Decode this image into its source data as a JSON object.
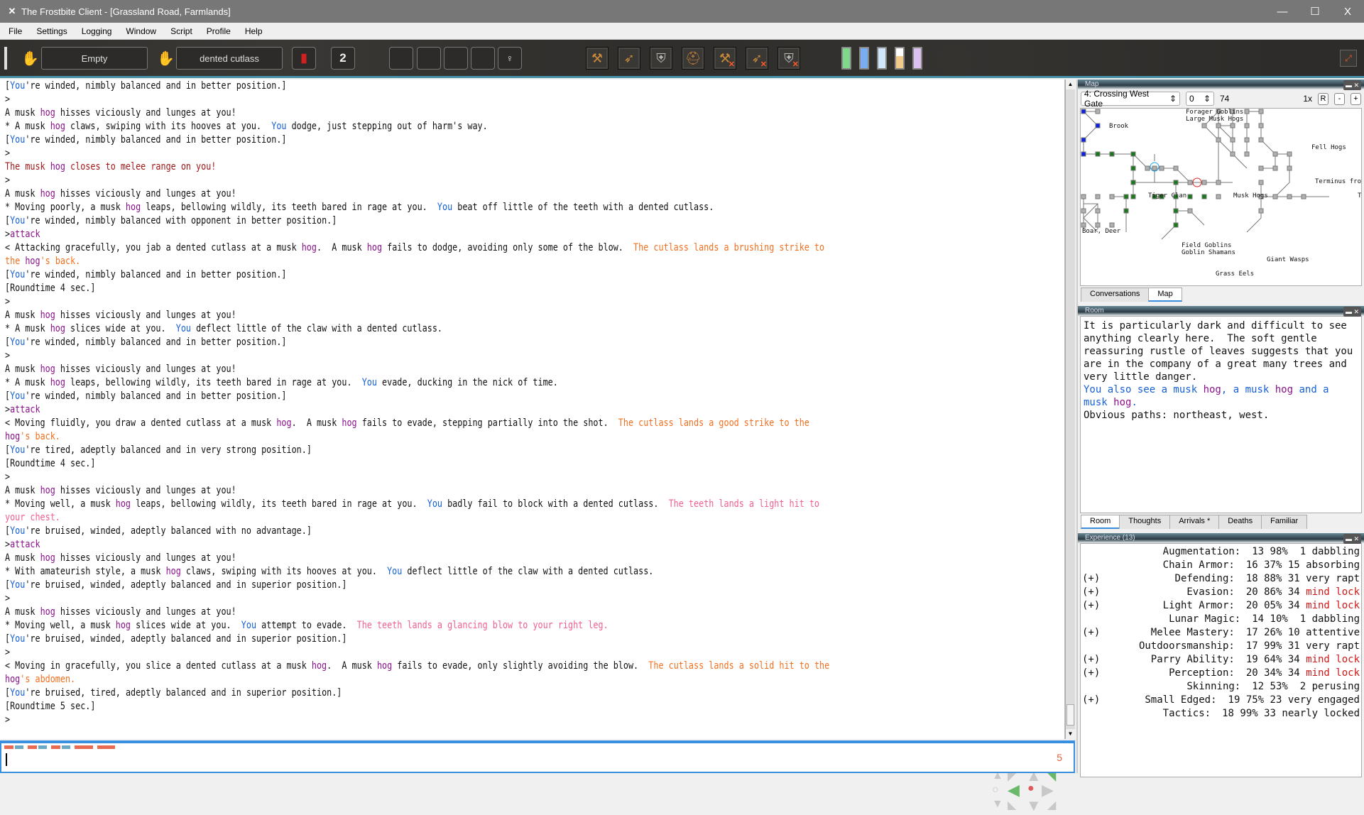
{
  "window": {
    "title": "The Frostbite Client - [Grassland Road, Farmlands]",
    "controls": {
      "minimize": "—",
      "maximize": "☐",
      "close": "X"
    }
  },
  "menu": [
    "File",
    "Settings",
    "Logging",
    "Window",
    "Script",
    "Profile",
    "Help"
  ],
  "toolbar": {
    "left_hand": "Empty",
    "right_hand": "dented cutlass",
    "spell_icon": "spellbook-icon",
    "count": "2",
    "stance_icon": "standing-figure-icon",
    "weapons": [
      {
        "icon": "axe-icon",
        "disabled": false
      },
      {
        "icon": "bow-icon",
        "disabled": false
      },
      {
        "icon": "shield-icon",
        "disabled": false
      },
      {
        "icon": "helmet-icon",
        "disabled": false
      },
      {
        "icon": "axe-icon",
        "disabled": true
      },
      {
        "icon": "bow-icon",
        "disabled": true
      },
      {
        "icon": "shield-icon",
        "disabled": true
      }
    ],
    "vitals": [
      {
        "name": "health",
        "color": "#7fd88a",
        "fill": 1.0
      },
      {
        "name": "mana",
        "color": "#78aef0",
        "fill": 1.0
      },
      {
        "name": "concentration",
        "color": "#cfe6fb",
        "fill": 1.0
      },
      {
        "name": "stamina",
        "color": "#f1c98a",
        "fill": 0.6
      },
      {
        "name": "spirit",
        "color": "#dcc0f0",
        "fill": 1.0
      }
    ]
  },
  "game_lines": [
    [
      [
        "[",
        ""
      ],
      [
        "You",
        "you"
      ],
      [
        "'re winded, nimbly balanced and in better position.]",
        ""
      ]
    ],
    [
      [
        ">",
        ""
      ]
    ],
    [
      [
        "A musk ",
        ""
      ],
      [
        "hog",
        "hog"
      ],
      [
        " hisses viciously and lunges at you!",
        ""
      ]
    ],
    [
      [
        "* A musk ",
        ""
      ],
      [
        "hog",
        "hog"
      ],
      [
        " claws, swiping with its hooves at you.  ",
        ""
      ],
      [
        "You",
        "you"
      ],
      [
        " dodge, just stepping out of harm's way.",
        ""
      ]
    ],
    [
      [
        "[",
        ""
      ],
      [
        "You",
        "you"
      ],
      [
        "'re winded, nimbly balanced and in better position.]",
        ""
      ]
    ],
    [
      [
        ">",
        ""
      ]
    ],
    [
      [
        "The musk ",
        "warn"
      ],
      [
        "hog",
        "hog"
      ],
      [
        " closes to melee range on you!",
        "warn"
      ]
    ],
    [
      [
        ">",
        ""
      ]
    ],
    [
      [
        "A musk ",
        ""
      ],
      [
        "hog",
        "hog"
      ],
      [
        " hisses viciously and lunges at you!",
        ""
      ]
    ],
    [
      [
        "* Moving poorly, a musk ",
        ""
      ],
      [
        "hog",
        "hog"
      ],
      [
        " leaps, bellowing wildly, its teeth bared in rage at you.  ",
        ""
      ],
      [
        "You",
        "you"
      ],
      [
        " beat off little of the teeth with a dented cutlass.",
        ""
      ]
    ],
    [
      [
        "[",
        ""
      ],
      [
        "You",
        "you"
      ],
      [
        "'re winded, nimbly balanced with opponent in better position.]",
        ""
      ]
    ],
    [
      [
        ">",
        ""
      ],
      [
        "attack",
        "cmd"
      ]
    ],
    [
      [
        "< Attacking gracefully, you jab a dented cutlass at a musk ",
        ""
      ],
      [
        "hog",
        "hog"
      ],
      [
        ".  A musk ",
        ""
      ],
      [
        "hog",
        "hog"
      ],
      [
        " fails to dodge, avoiding only some of the blow.  ",
        ""
      ],
      [
        "The cutlass lands a brushing strike to",
        "dmg"
      ]
    ],
    [
      [
        "the ",
        "dmg"
      ],
      [
        "hog",
        "hog"
      ],
      [
        "'s back.",
        "dmg"
      ]
    ],
    [
      [
        "[",
        ""
      ],
      [
        "You",
        "you"
      ],
      [
        "'re winded, nimbly balanced and in better position.]",
        ""
      ]
    ],
    [
      [
        "[Roundtime 4 sec.]",
        ""
      ]
    ],
    [
      [
        ">",
        ""
      ]
    ],
    [
      [
        "A musk ",
        ""
      ],
      [
        "hog",
        "hog"
      ],
      [
        " hisses viciously and lunges at you!",
        ""
      ]
    ],
    [
      [
        "* A musk ",
        ""
      ],
      [
        "hog",
        "hog"
      ],
      [
        " slices wide at you.  ",
        ""
      ],
      [
        "You",
        "you"
      ],
      [
        " deflect little of the claw with a dented cutlass.",
        ""
      ]
    ],
    [
      [
        "[",
        ""
      ],
      [
        "You",
        "you"
      ],
      [
        "'re winded, nimbly balanced and in better position.]",
        ""
      ]
    ],
    [
      [
        ">",
        ""
      ]
    ],
    [
      [
        "A musk ",
        ""
      ],
      [
        "hog",
        "hog"
      ],
      [
        " hisses viciously and lunges at you!",
        ""
      ]
    ],
    [
      [
        "* A musk ",
        ""
      ],
      [
        "hog",
        "hog"
      ],
      [
        " leaps, bellowing wildly, its teeth bared in rage at you.  ",
        ""
      ],
      [
        "You",
        "you"
      ],
      [
        " evade, ducking in the nick of time.",
        ""
      ]
    ],
    [
      [
        "[",
        ""
      ],
      [
        "You",
        "you"
      ],
      [
        "'re winded, nimbly balanced and in better position.]",
        ""
      ]
    ],
    [
      [
        ">",
        ""
      ],
      [
        "attack",
        "cmd"
      ]
    ],
    [
      [
        "< Moving fluidly, you draw a dented cutlass at a musk ",
        ""
      ],
      [
        "hog",
        "hog"
      ],
      [
        ".  A musk ",
        ""
      ],
      [
        "hog",
        "hog"
      ],
      [
        " fails to evade, stepping partially into the shot.  ",
        ""
      ],
      [
        "The cutlass lands a good strike to the",
        "dmg"
      ]
    ],
    [
      [
        "hog",
        "hog"
      ],
      [
        "'s back.",
        "dmg"
      ]
    ],
    [
      [
        "[",
        ""
      ],
      [
        "You",
        "you"
      ],
      [
        "'re tired, adeptly balanced and in very strong position.]",
        ""
      ]
    ],
    [
      [
        "[Roundtime 4 sec.]",
        ""
      ]
    ],
    [
      [
        ">",
        ""
      ]
    ],
    [
      [
        "A musk ",
        ""
      ],
      [
        "hog",
        "hog"
      ],
      [
        " hisses viciously and lunges at you!",
        ""
      ]
    ],
    [
      [
        "* Moving well, a musk ",
        ""
      ],
      [
        "hog",
        "hog"
      ],
      [
        " leaps, bellowing wildly, its teeth bared in rage at you.  ",
        ""
      ],
      [
        "You",
        "you"
      ],
      [
        " badly fail to block with a dented cutlass.  ",
        ""
      ],
      [
        "The teeth lands a light hit to",
        "hit"
      ]
    ],
    [
      [
        "your chest.",
        "hit"
      ]
    ],
    [
      [
        "[",
        ""
      ],
      [
        "You",
        "you"
      ],
      [
        "'re bruised, winded, adeptly balanced with no advantage.]",
        ""
      ]
    ],
    [
      [
        ">",
        ""
      ],
      [
        "attack",
        "cmd"
      ]
    ],
    [
      [
        "A musk ",
        ""
      ],
      [
        "hog",
        "hog"
      ],
      [
        " hisses viciously and lunges at you!",
        ""
      ]
    ],
    [
      [
        "* With amateurish style, a musk ",
        ""
      ],
      [
        "hog",
        "hog"
      ],
      [
        " claws, swiping with its hooves at you.  ",
        ""
      ],
      [
        "You",
        "you"
      ],
      [
        " deflect little of the claw with a dented cutlass.",
        ""
      ]
    ],
    [
      [
        "[",
        ""
      ],
      [
        "You",
        "you"
      ],
      [
        "'re bruised, winded, adeptly balanced and in superior position.]",
        ""
      ]
    ],
    [
      [
        ">",
        ""
      ]
    ],
    [
      [
        "A musk ",
        ""
      ],
      [
        "hog",
        "hog"
      ],
      [
        " hisses viciously and lunges at you!",
        ""
      ]
    ],
    [
      [
        "* Moving well, a musk ",
        ""
      ],
      [
        "hog",
        "hog"
      ],
      [
        " slices wide at you.  ",
        ""
      ],
      [
        "You",
        "you"
      ],
      [
        " attempt to evade.  ",
        ""
      ],
      [
        "The teeth lands a glancing blow to your right leg.",
        "hit"
      ]
    ],
    [
      [
        "[",
        ""
      ],
      [
        "You",
        "you"
      ],
      [
        "'re bruised, winded, adeptly balanced and in superior position.]",
        ""
      ]
    ],
    [
      [
        ">",
        ""
      ]
    ],
    [
      [
        "< Moving in gracefully, you slice a dented cutlass at a musk ",
        ""
      ],
      [
        "hog",
        "hog"
      ],
      [
        ".  A musk ",
        ""
      ],
      [
        "hog",
        "hog"
      ],
      [
        " fails to evade, only slightly avoiding the blow.  ",
        ""
      ],
      [
        "The cutlass lands a solid hit to the",
        "dmg"
      ]
    ],
    [
      [
        "hog",
        "hog"
      ],
      [
        "'s abdomen.",
        "dmg"
      ]
    ],
    [
      [
        "[",
        ""
      ],
      [
        "You",
        "you"
      ],
      [
        "'re bruised, tired, adeptly balanced and in superior position.]",
        ""
      ]
    ],
    [
      [
        "[Roundtime 5 sec.]",
        ""
      ]
    ],
    [
      [
        ">",
        ""
      ]
    ]
  ],
  "input": {
    "value": "",
    "count": "5",
    "roundtime_segments": [
      {
        "color": "#e86a50"
      },
      {
        "color": "#6aa8c4"
      },
      {
        "color": "#e86a50"
      },
      {
        "color": "#6aa8c4"
      },
      {
        "color": "#e86a50"
      },
      {
        "color": "#6aa8c4"
      },
      {
        "color": "#e86a50"
      },
      {
        "color": "#e86a50"
      }
    ]
  },
  "map": {
    "title": "Map",
    "zone": "4: Crossing West Gate",
    "level": "0",
    "room_id": "74",
    "zoom": "1x",
    "reset_label": "R",
    "zoom_out_label": "-",
    "zoom_in_label": "+",
    "labels": [
      "Forager Goblins",
      "Large Musk Hogs",
      "Brook",
      "Fell Hogs",
      "Tiger Clan",
      "Musk Hogs",
      "Terminus from",
      "Trai",
      "Boar, Deer",
      "Field Goblins",
      "Goblin Shamans",
      "Giant Wasps",
      "Grass Eels"
    ]
  },
  "top_tabs": [
    {
      "label": "Conversations",
      "active": false
    },
    {
      "label": "Map",
      "active": true
    }
  ],
  "room": {
    "title": "Room",
    "description": "It is particularly dark and difficult to see anything clearly here.  The soft gentle reassuring rustle of leaves suggests that you are in the company of a great many trees and very little danger.",
    "also_see": [
      [
        "You also see a musk ",
        "you"
      ],
      [
        "hog",
        "hog"
      ],
      [
        ", a musk ",
        "you"
      ],
      [
        "hog",
        "hog"
      ],
      [
        " and a musk ",
        "you"
      ],
      [
        "hog",
        "hog"
      ],
      [
        ".",
        "you"
      ]
    ],
    "paths": "Obvious paths: northeast, west."
  },
  "mid_tabs": [
    {
      "label": "Room",
      "active": true
    },
    {
      "label": "Thoughts",
      "active": false
    },
    {
      "label": "Arrivals *",
      "active": false
    },
    {
      "label": "Deaths",
      "active": false
    },
    {
      "label": "Familiar",
      "active": false
    }
  ],
  "experience": {
    "title": "Experience (13)",
    "skills": [
      {
        "plus": "",
        "name": "Augmentation:",
        "rank": "13",
        "pct": "98%",
        "mind": " 1",
        "state": "dabbling",
        "lock": false
      },
      {
        "plus": "",
        "name": "Chain Armor:",
        "rank": "16",
        "pct": "37%",
        "mind": "15",
        "state": "absorbing",
        "lock": false
      },
      {
        "plus": "(+)",
        "name": "Defending:",
        "rank": "18",
        "pct": "88%",
        "mind": "31",
        "state": "very rapt",
        "lock": false
      },
      {
        "plus": "(+)",
        "name": "Evasion:",
        "rank": "20",
        "pct": "86%",
        "mind": "34",
        "state": "mind lock",
        "lock": true
      },
      {
        "plus": "(+)",
        "name": "Light Armor:",
        "rank": "20",
        "pct": "05%",
        "mind": "34",
        "state": "mind lock",
        "lock": true
      },
      {
        "plus": "",
        "name": "Lunar Magic:",
        "rank": "14",
        "pct": "10%",
        "mind": " 1",
        "state": "dabbling",
        "lock": false
      },
      {
        "plus": "(+)",
        "name": "Melee Mastery:",
        "rank": "17",
        "pct": "26%",
        "mind": "10",
        "state": "attentive",
        "lock": false
      },
      {
        "plus": "",
        "name": "Outdoorsmanship:",
        "rank": "17",
        "pct": "99%",
        "mind": "31",
        "state": "very rapt",
        "lock": false
      },
      {
        "plus": "(+)",
        "name": "Parry Ability:",
        "rank": "19",
        "pct": "64%",
        "mind": "34",
        "state": "mind lock",
        "lock": true
      },
      {
        "plus": "(+)",
        "name": "Perception:",
        "rank": "20",
        "pct": "34%",
        "mind": "34",
        "state": "mind lock",
        "lock": true
      },
      {
        "plus": "",
        "name": "Skinning:",
        "rank": "12",
        "pct": "53%",
        "mind": " 2",
        "state": "perusing",
        "lock": false
      },
      {
        "plus": "(+)",
        "name": "Small Edged:",
        "rank": "19",
        "pct": "75%",
        "mind": "23",
        "state": "very engaged",
        "lock": false
      },
      {
        "plus": "",
        "name": "Tactics:",
        "rank": "18",
        "pct": "99%",
        "mind": "33",
        "state": "nearly locked",
        "lock": false
      }
    ]
  },
  "compass": {
    "available_exits": [
      "west",
      "northeast"
    ],
    "current": "center"
  }
}
